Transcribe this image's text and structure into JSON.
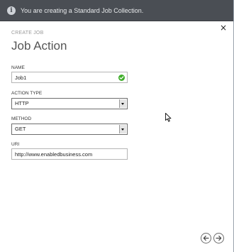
{
  "banner": {
    "message": "You are creating a Standard Job Collection.",
    "icon": "info-icon"
  },
  "header": {
    "step": "CREATE JOB",
    "title": "Job Action",
    "close_icon": "close-icon",
    "close_glyph": "×"
  },
  "form": {
    "name": {
      "label": "NAME",
      "value": "Job1",
      "valid": true
    },
    "action_type": {
      "label": "ACTION TYPE",
      "value": "HTTP"
    },
    "method": {
      "label": "METHOD",
      "value": "GET"
    },
    "uri": {
      "label": "URI",
      "value": "http://www.enabledbusiness.com"
    }
  },
  "footer": {
    "back_icon": "arrow-left-icon",
    "next_icon": "arrow-right-icon"
  },
  "colors": {
    "banner_bg": "#4a4e54",
    "valid": "#3fae2a"
  }
}
